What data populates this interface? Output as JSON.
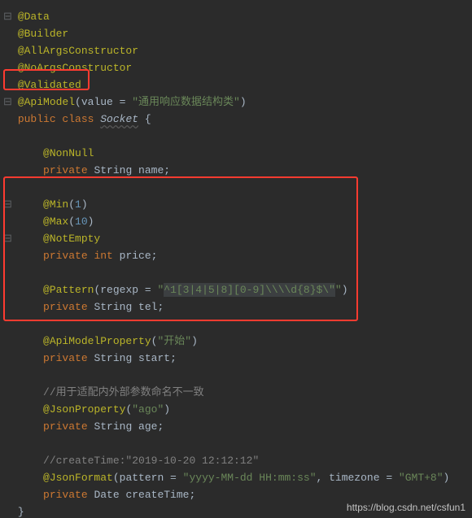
{
  "gutter": {
    "fold": "⊟"
  },
  "code": {
    "data": "@Data",
    "builder": "@Builder",
    "allArgs": "@AllArgsConstructor",
    "noArgs": "@NoArgsConstructor",
    "validated": "@Validated",
    "apiModel": {
      "at": "@ApiModel",
      "open": "(value = ",
      "str": "\"通用响应数据结构类\"",
      "close": ")"
    },
    "classDecl": {
      "kw1": "public ",
      "kw2": "class ",
      "name": "Socket",
      "brace": " {"
    },
    "nonNull": "@NonNull",
    "nameField": {
      "kw": "private ",
      "type": "String ",
      "id": "name",
      "semi": ";"
    },
    "min": {
      "at": "@Min",
      "open": "(",
      "num": "1",
      "close": ")"
    },
    "max": {
      "at": "@Max",
      "open": "(",
      "num": "10",
      "close": ")"
    },
    "notEmpty": "@NotEmpty",
    "priceField": {
      "kw": "private ",
      "type": "int ",
      "id": "price",
      "semi": ";"
    },
    "pattern": {
      "at": "@Pattern",
      "open": "(regexp = ",
      "strOpen": "\"",
      "body": "^1[3|4|5|8][0-9]\\\\\\\\d{8}$\\\"",
      "strClose": "\"",
      "close": ")"
    },
    "telField": {
      "kw": "private ",
      "type": "String ",
      "id": "tel",
      "semi": ";"
    },
    "apiModelProp": {
      "at": "@ApiModelProperty",
      "open": "(",
      "str": "\"开始\"",
      "close": ")"
    },
    "startField": {
      "kw": "private ",
      "type": "String ",
      "id": "start",
      "semi": ";"
    },
    "comment1": "//用于适配内外部参数命名不一致",
    "jsonProp": {
      "at": "@JsonProperty",
      "open": "(",
      "str": "\"ago\"",
      "close": ")"
    },
    "ageField": {
      "kw": "private ",
      "type": "String ",
      "id": "age",
      "semi": ";"
    },
    "comment2": "//createTime:\"2019-10-20 12:12:12\"",
    "jsonFormat": {
      "at": "@JsonFormat",
      "open": "(pattern = ",
      "str1": "\"yyyy-MM-dd HH:mm:ss\"",
      "mid": ", timezone = ",
      "str2": "\"GMT+8\"",
      "close": ")"
    },
    "createTimeField": {
      "kw": "private ",
      "type": "Date ",
      "id": "createTime",
      "semi": ";"
    },
    "closeBrace": "}"
  },
  "watermark": "https://blog.csdn.net/csfun1"
}
